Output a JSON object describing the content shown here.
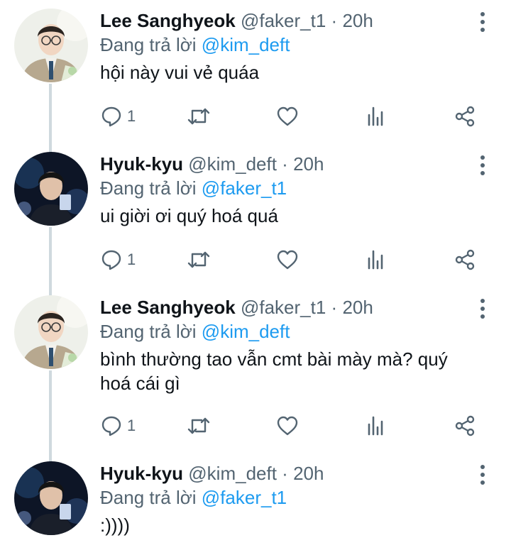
{
  "tweets": [
    {
      "name": "Lee Sanghyeok",
      "handle": "@faker_t1",
      "time": "20h",
      "reply_prefix": "Đang trả lời",
      "reply_to": "@kim_deft",
      "text": "hội này vui vẻ quáa",
      "reply_count": "1",
      "avatar_style": "light"
    },
    {
      "name": "Hyuk-kyu",
      "handle": "@kim_deft",
      "time": "20h",
      "reply_prefix": "Đang trả lời",
      "reply_to": "@faker_t1",
      "text": "ui giời ơi quý hoá quá",
      "reply_count": "1",
      "avatar_style": "dark"
    },
    {
      "name": "Lee Sanghyeok",
      "handle": "@faker_t1",
      "time": "20h",
      "reply_prefix": "Đang trả lời",
      "reply_to": "@kim_deft",
      "text": "bình thường tao vẫn cmt bài mày mà? quý hoá cái gì",
      "reply_count": "1",
      "avatar_style": "light"
    },
    {
      "name": "Hyuk-kyu",
      "handle": "@kim_deft",
      "time": "20h",
      "reply_prefix": "Đang trả lời",
      "reply_to": "@faker_t1",
      "text": ":))))",
      "avatar_style": "dark"
    }
  ],
  "separator": "·",
  "icons": [
    "reply-icon",
    "retweet-icon",
    "like-icon",
    "analytics-icon",
    "share-icon",
    "more-icon"
  ],
  "colors": {
    "mention": "#1d9bf0",
    "secondary": "#536471",
    "thread_line": "#cfd9de"
  }
}
